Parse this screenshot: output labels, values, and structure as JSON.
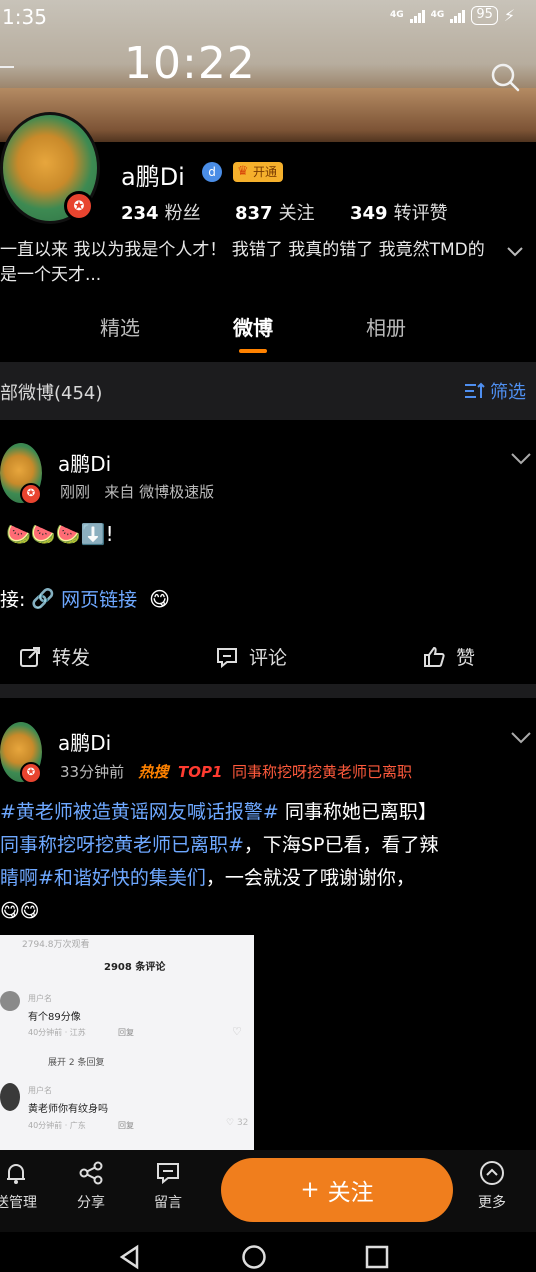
{
  "status_bar": {
    "time": "1:35",
    "network_1": "4G",
    "network_2": "4G",
    "battery": "95"
  },
  "overlay_clock": "10:22",
  "profile": {
    "name": "a鹏Di",
    "vip_label": "开通",
    "fans_count": "234",
    "fans_label": "粉丝",
    "follow_count": "837",
    "follow_label": "关注",
    "repost_count": "349",
    "repost_label": "转评赞",
    "bio": "一直以来 我以为我是个人才！ 我错了 我真的错了 我竟然TMD的是一个天才..."
  },
  "tabs": [
    {
      "label": "精选",
      "active": false
    },
    {
      "label": "微博",
      "active": true
    },
    {
      "label": "相册",
      "active": false
    }
  ],
  "filter": {
    "count_label": "部微博(454)",
    "filter_label": "筛选"
  },
  "posts": [
    {
      "name": "a鹏Di",
      "time": "刚刚",
      "source": "来自 微博极速版",
      "text": "🍉🍉🍉⬇️!",
      "link_prefix": "接:",
      "link_label": "网页链接",
      "actions": {
        "repost": "转发",
        "comment": "评论",
        "like": "赞"
      }
    },
    {
      "name": "a鹏Di",
      "time": "33分钟前",
      "hot_tag": "热搜",
      "top_tag": "TOP1",
      "hot_topic": "同事称挖呀挖黄老师已离职",
      "text_line1_topic": "#黄老师被造黄谣网友喊话报警#",
      "text_line1_rest": " 同事称她已离职】",
      "text_line2_topic": "同事称挖呀挖黄老师已离职#",
      "text_line2_rest": "，下海SP已看，看了辣",
      "text_line3_topic": "睛啊#和谐好快的集美们",
      "text_line3_rest": "，一会就没了哦谢谢你，",
      "image": {
        "header_faint": "2794.8万次观看",
        "comment_count": "2908 条评论",
        "c1_user": "用户名",
        "c1_text": "有个89分像",
        "c1_meta": "40分钟前 · 江苏",
        "c1_reply": "回复",
        "expand": "展开 2 条回复",
        "c2_user": "用户名",
        "c2_text": "黄老师你有纹身吗",
        "c2_meta": "40分钟前 · 广东",
        "c2_reply": "回复",
        "c2_likes": "32"
      }
    }
  ],
  "toolbar": {
    "manage": "送管理",
    "share": "分享",
    "message": "留言",
    "follow": "关注",
    "more": "更多"
  },
  "colors": {
    "accent": "#ff8200",
    "link": "#4f8ff0",
    "follow_button": "#f07e1d"
  }
}
